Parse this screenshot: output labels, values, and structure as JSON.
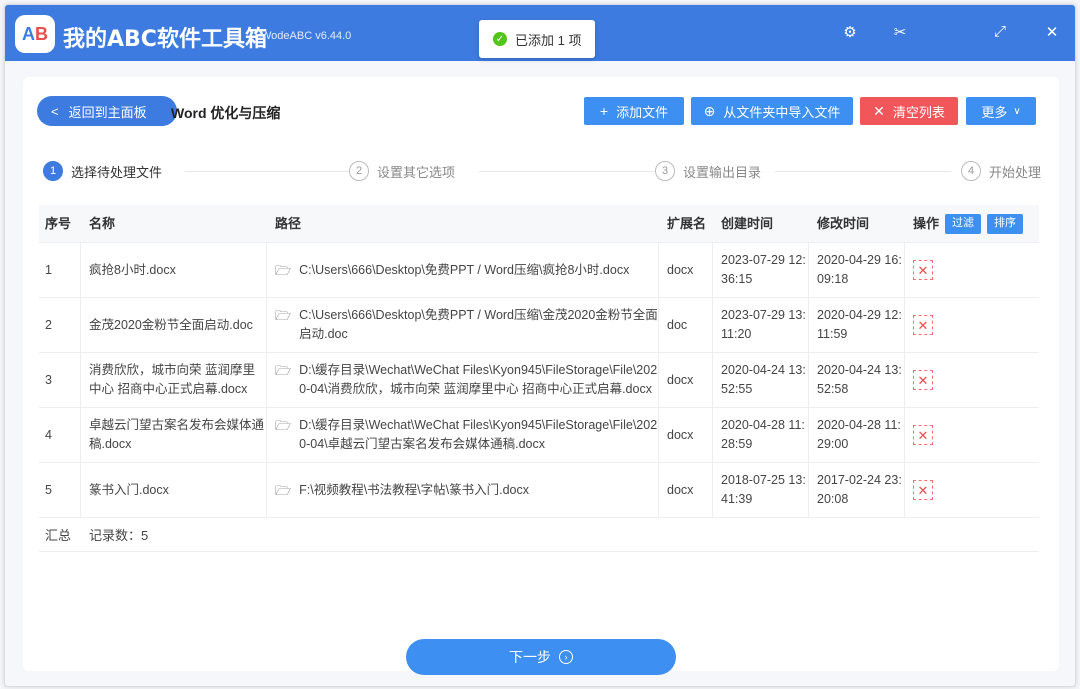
{
  "app": {
    "logo_text_a": "A",
    "logo_text_b": "B",
    "title": "我的ABC软件工具箱",
    "version": "WodeABC v6.44.0"
  },
  "toast": {
    "text": "已添加 1 项"
  },
  "toolbar": {
    "back_label": "返回到主面板",
    "page_title": "Word 优化与压缩",
    "add_file_label": "添加文件",
    "import_folder_label": "从文件夹中导入文件",
    "clear_list_label": "清空列表",
    "more_label": "更多"
  },
  "steps": [
    {
      "num": "1",
      "label": "选择待处理文件"
    },
    {
      "num": "2",
      "label": "设置其它选项"
    },
    {
      "num": "3",
      "label": "设置输出目录"
    },
    {
      "num": "4",
      "label": "开始处理"
    }
  ],
  "table": {
    "headers": {
      "idx": "序号",
      "name": "名称",
      "path": "路径",
      "ext": "扩展名",
      "created": "创建时间",
      "modified": "修改时间",
      "op": "操作",
      "filter": "过滤",
      "sort": "排序"
    },
    "rows": [
      {
        "idx": "1",
        "name": "疯抢8小时.docx",
        "path": "C:\\Users\\666\\Desktop\\免费PPT / Word压缩\\疯抢8小时.docx",
        "ext": "docx",
        "created": "2023-07-29 12:36:15",
        "modified": "2020-04-29 16:09:18"
      },
      {
        "idx": "2",
        "name": "金茂2020金粉节全面启动.doc",
        "path": "C:\\Users\\666\\Desktop\\免费PPT / Word压缩\\金茂2020金粉节全面启动.doc",
        "ext": "doc",
        "created": "2023-07-29 13:11:20",
        "modified": "2020-04-29 12:11:59"
      },
      {
        "idx": "3",
        "name": "消费欣欣，城市向荣 蓝润摩里中心 招商中心正式启幕.docx",
        "path": "D:\\缓存目录\\Wechat\\WeChat Files\\Kyon945\\FileStorage\\File\\2020-04\\消费欣欣，城市向荣 蓝润摩里中心 招商中心正式启幕.docx",
        "ext": "docx",
        "created": "2020-04-24 13:52:55",
        "modified": "2020-04-24 13:52:58"
      },
      {
        "idx": "4",
        "name": "卓越云门望古案名发布会媒体通稿.docx",
        "path": "D:\\缓存目录\\Wechat\\WeChat Files\\Kyon945\\FileStorage\\File\\2020-04\\卓越云门望古案名发布会媒体通稿.docx",
        "ext": "docx",
        "created": "2020-04-28 11:28:59",
        "modified": "2020-04-28 11:29:00"
      },
      {
        "idx": "5",
        "name": "篆书入门.docx",
        "path": "F:\\视频教程\\书法教程\\字帖\\篆书入门.docx",
        "ext": "docx",
        "created": "2018-07-25 13:41:39",
        "modified": "2017-02-24 23:20:08"
      }
    ],
    "summary_label": "汇总",
    "summary_count": "记录数：5"
  },
  "footer": {
    "next_label": "下一步"
  }
}
